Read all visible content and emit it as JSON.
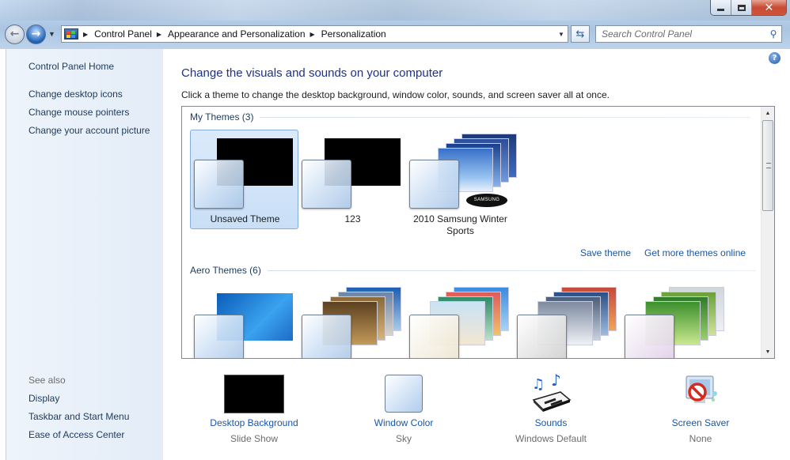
{
  "window": {
    "buttons": {
      "minimize": "minimize",
      "maximize": "maximize",
      "close": "close"
    }
  },
  "address_bar": {
    "crumbs": [
      "Control Panel",
      "Appearance and Personalization",
      "Personalization"
    ]
  },
  "search": {
    "placeholder": "Search Control Panel"
  },
  "sidebar": {
    "home": "Control Panel Home",
    "links": [
      "Change desktop icons",
      "Change mouse pointers",
      "Change your account picture"
    ],
    "see_also_label": "See also",
    "see_also": [
      "Display",
      "Taskbar and Start Menu",
      "Ease of Access Center"
    ]
  },
  "main": {
    "title": "Change the visuals and sounds on your computer",
    "subtitle": "Click a theme to change the desktop background, window color, sounds, and screen saver all at once.",
    "my_themes": {
      "label": "My Themes (3)",
      "items": [
        {
          "name": "Unsaved Theme",
          "selected": true
        },
        {
          "name": "123",
          "selected": false
        },
        {
          "name": "2010 Samsung Winter Sports",
          "selected": false
        }
      ]
    },
    "samsung_logo": "SAMSUNG",
    "save_theme": "Save theme",
    "get_more": "Get more themes online",
    "aero_themes": {
      "label": "Aero Themes (6)",
      "count_visible": 5
    }
  },
  "settings": [
    {
      "name": "Desktop Background",
      "value": "Slide Show",
      "icon": "black-wallpaper-icon"
    },
    {
      "name": "Window Color",
      "value": "Sky",
      "icon": "window-color-swatch-icon"
    },
    {
      "name": "Sounds",
      "value": "Windows Default",
      "icon": "music-keyboard-icon"
    },
    {
      "name": "Screen Saver",
      "value": "None",
      "icon": "screen-saver-icon"
    }
  ],
  "colors": {
    "accent_link": "#1a56a8",
    "title": "#1e3287",
    "selection": "#c9dff6"
  }
}
